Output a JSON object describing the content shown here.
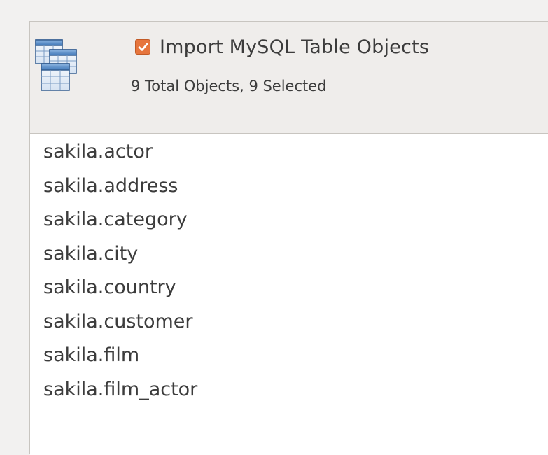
{
  "header": {
    "import_checkbox_label": "Import MySQL Table Objects",
    "import_checked": true,
    "summary": "9 Total Objects, 9 Selected",
    "icon": "table-stack-icon"
  },
  "objects": [
    "sakila.actor",
    "sakila.address",
    "sakila.category",
    "sakila.city",
    "sakila.country",
    "sakila.customer",
    "sakila.film",
    "sakila.film_actor"
  ],
  "colors": {
    "checkbox_accent": "#e6753d",
    "text": "#3c3c3c",
    "list_background": "#ffffff"
  }
}
